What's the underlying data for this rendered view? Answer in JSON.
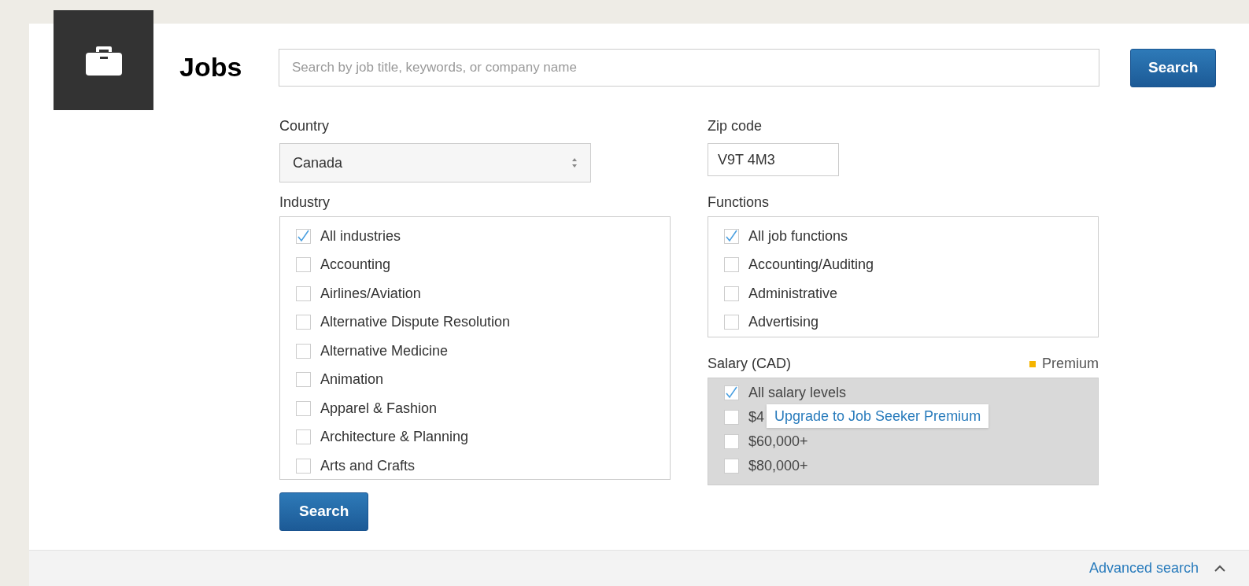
{
  "header": {
    "title": "Jobs",
    "search": {
      "placeholder": "Search by job title, keywords, or company name"
    },
    "search_button": "Search"
  },
  "country": {
    "label": "Country",
    "value": "Canada"
  },
  "zip_code": {
    "label": "Zip code",
    "value": "V9T 4M3"
  },
  "industry": {
    "label": "Industry",
    "options": [
      {
        "label": "All industries",
        "checked": true
      },
      {
        "label": "Accounting",
        "checked": false
      },
      {
        "label": "Airlines/Aviation",
        "checked": false
      },
      {
        "label": "Alternative Dispute Resolution",
        "checked": false
      },
      {
        "label": "Alternative Medicine",
        "checked": false
      },
      {
        "label": "Animation",
        "checked": false
      },
      {
        "label": "Apparel & Fashion",
        "checked": false
      },
      {
        "label": "Architecture & Planning",
        "checked": false
      },
      {
        "label": "Arts and Crafts",
        "checked": false
      }
    ]
  },
  "functions": {
    "label": "Functions",
    "options": [
      {
        "label": "All job functions",
        "checked": true
      },
      {
        "label": "Accounting/Auditing",
        "checked": false
      },
      {
        "label": "Administrative",
        "checked": false
      },
      {
        "label": "Advertising",
        "checked": false
      }
    ]
  },
  "salary": {
    "label": "Salary (CAD)",
    "badge": "Premium",
    "disabled": true,
    "options": [
      {
        "label": "All salary levels",
        "checked": true
      },
      {
        "label": "$4",
        "checked": false
      },
      {
        "label": "$60,000+",
        "checked": false
      },
      {
        "label": "$80,000+",
        "checked": false
      }
    ],
    "tooltip": "Upgrade to Job Seeker Premium"
  },
  "search_button": "Search",
  "footer": {
    "link": "Advanced search",
    "expanded": true
  }
}
